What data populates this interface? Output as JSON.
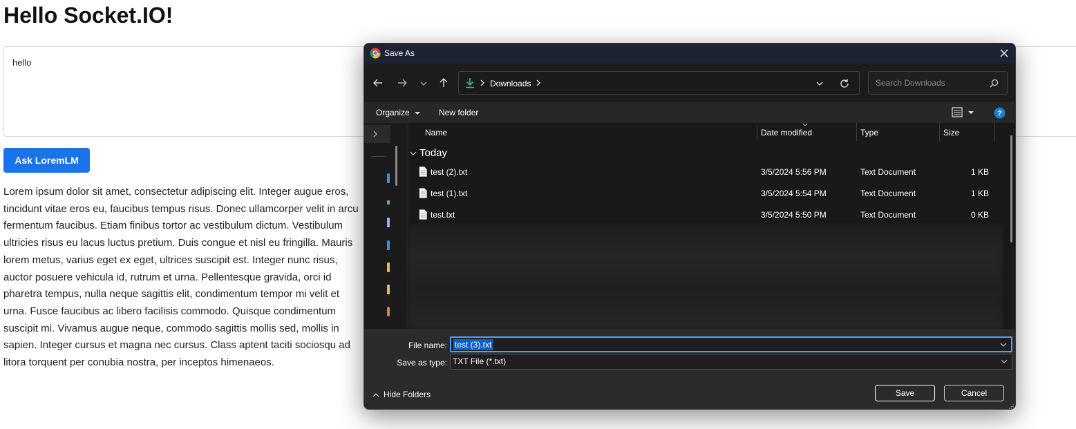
{
  "page": {
    "title": "Hello Socket.IO!",
    "prompt_value": "hello",
    "ask_button": "Ask LoremLM",
    "response_text": "Lorem ipsum dolor sit amet, consectetur adipiscing elit. Integer augue eros, tincidunt vitae eros eu, faucibus tempus risus. Donec ullamcorper velit in arcu fermentum faucibus. Etiam finibus tortor ac vestibulum dictum. Vestibulum ultricies risus eu lacus luctus pretium. Duis congue et nisl eu fringilla. Mauris lorem metus, varius eget ex eget, ultrices suscipit est. Integer nunc risus, auctor posuere vehicula id, rutrum et urna. Pellentesque gravida, orci id pharetra tempus, nulla neque sagittis elit, condimentum tempor mi velit et urna. Fusce faucibus ac libero facilisis commodo. Quisque condimentum suscipit mi. Vivamus augue neque, commodo sagittis mollis sed, mollis in sapien. Integer cursus et magna nec cursus. Class aptent taciti sociosqu ad litora torquent per conubia nostra, per inceptos himenaeos."
  },
  "dialog": {
    "title": "Save As",
    "address_location": "Downloads",
    "search_placeholder": "Search Downloads",
    "organize_label": "Organize",
    "new_folder_label": "New folder",
    "columns": {
      "name": "Name",
      "date": "Date modified",
      "type": "Type",
      "size": "Size"
    },
    "group_label": "Today",
    "files": [
      {
        "name": "test (2).txt",
        "date": "3/5/2024 5:56 PM",
        "type": "Text Document",
        "size": "1 KB"
      },
      {
        "name": "test (1).txt",
        "date": "3/5/2024 5:54 PM",
        "type": "Text Document",
        "size": "1 KB"
      },
      {
        "name": "test.txt",
        "date": "3/5/2024 5:50 PM",
        "type": "Text Document",
        "size": "0 KB"
      }
    ],
    "file_name_label": "File name:",
    "file_name_value": "test (3).txt",
    "save_type_label": "Save as type:",
    "save_type_value": "TXT File (*.txt)",
    "hide_folders_label": "Hide Folders",
    "save_button": "Save",
    "cancel_button": "Cancel"
  },
  "colors": {
    "accent": "#1a73e8",
    "dialog_bg": "#202020",
    "titlebar_bg": "#1c2333",
    "selection": "#0a62c9"
  },
  "icons": [
    "chrome-icon",
    "close-icon",
    "back-arrow-icon",
    "forward-arrow-icon",
    "chevron-down-icon",
    "up-arrow-icon",
    "download-icon",
    "refresh-icon",
    "search-icon",
    "view-options-icon",
    "help-icon",
    "text-file-icon"
  ]
}
